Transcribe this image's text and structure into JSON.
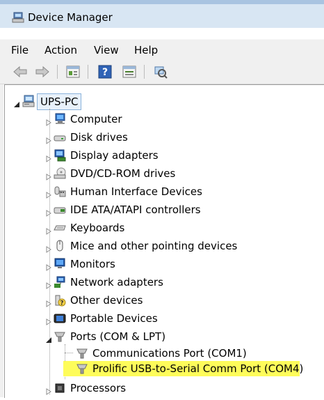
{
  "window": {
    "title": "Device Manager"
  },
  "menu": [
    "File",
    "Action",
    "View",
    "Help"
  ],
  "toolbar": {
    "buttons": [
      {
        "name": "back-arrow-icon"
      },
      {
        "name": "forward-arrow-icon"
      },
      {
        "name": "properties-icon"
      },
      {
        "name": "help-icon"
      },
      {
        "name": "view-icon"
      },
      {
        "name": "scan-hardware-icon"
      }
    ]
  },
  "tree": {
    "root": {
      "label": "UPS-PC",
      "icon": "computer-icon"
    },
    "categories": [
      {
        "label": "Computer",
        "icon": "computer-icon"
      },
      {
        "label": "Disk drives",
        "icon": "disk-drive-icon"
      },
      {
        "label": "Display adapters",
        "icon": "display-adapter-icon"
      },
      {
        "label": "DVD/CD-ROM drives",
        "icon": "dvd-drive-icon"
      },
      {
        "label": "Human Interface Devices",
        "icon": "hid-icon"
      },
      {
        "label": "IDE ATA/ATAPI controllers",
        "icon": "ide-controller-icon"
      },
      {
        "label": "Keyboards",
        "icon": "keyboard-icon"
      },
      {
        "label": "Mice and other pointing devices",
        "icon": "mouse-icon"
      },
      {
        "label": "Monitors",
        "icon": "monitor-icon"
      },
      {
        "label": "Network adapters",
        "icon": "network-adapter-icon"
      },
      {
        "label": "Other devices",
        "icon": "other-devices-icon"
      },
      {
        "label": "Portable Devices",
        "icon": "portable-device-icon"
      },
      {
        "label": "Ports (COM & LPT)",
        "icon": "port-icon",
        "expanded": true
      },
      {
        "label": "Processors",
        "icon": "processor-icon"
      }
    ],
    "ports_children": [
      {
        "label": "Communications Port (COM1)",
        "icon": "port-icon"
      },
      {
        "label": "Prolific USB-to-Serial Comm Port (COM4)",
        "icon": "port-icon",
        "highlighted": true
      }
    ]
  },
  "colors": {
    "highlight": "#fefc5a",
    "titlebar": "#d8e6f3"
  }
}
